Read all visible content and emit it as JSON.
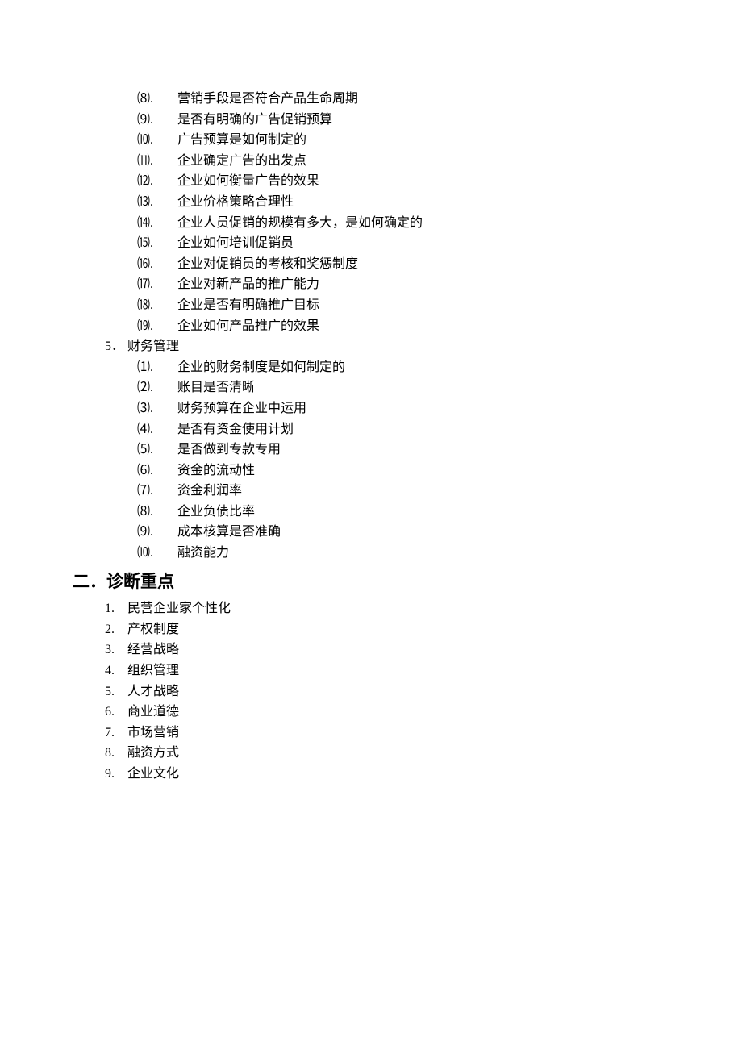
{
  "topList": {
    "startIndex": 8,
    "items": [
      "营销手段是否符合产品生命周期",
      "是否有明确的广告促销预算",
      "广告预算是如何制定的",
      "企业确定广告的出发点",
      "企业如何衡量广告的效果",
      "企业价格策略合理性",
      "企业人员促销的规模有多大，是如何确定的",
      "企业如何培训促销员",
      "企业对促销员的考核和奖惩制度",
      "企业对新产品的推广能力",
      "企业是否有明确推广目标",
      "企业如何产品推广的效果"
    ]
  },
  "section5": {
    "marker": "5．",
    "title": "财务管理",
    "items": [
      "企业的财务制度是如何制定的",
      "账目是否清晰",
      "财务预算在企业中运用",
      "是否有资金使用计划",
      "是否做到专款专用",
      "资金的流动性",
      "资金利润率",
      "企业负债比率",
      "成本核算是否准确",
      "融资能力"
    ]
  },
  "section2": {
    "title": "二．诊断重点",
    "items": [
      "民营企业家个性化",
      "产权制度",
      "经营战略",
      "组织管理",
      "人才战略",
      "商业道德",
      "市场营销",
      "融资方式",
      "企业文化"
    ]
  }
}
